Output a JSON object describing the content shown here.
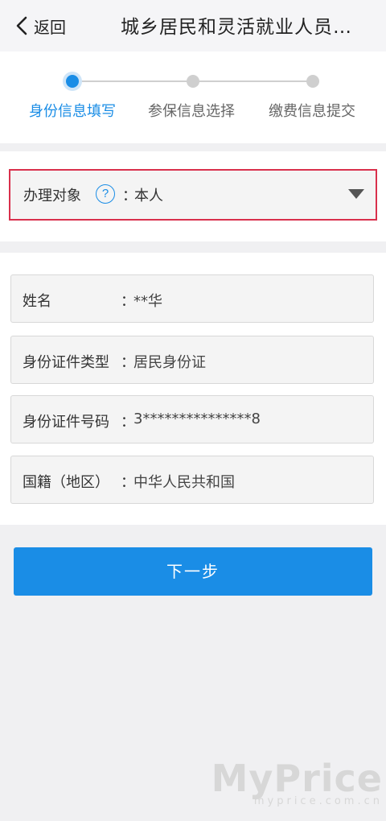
{
  "header": {
    "back_label": "返回",
    "title": "城乡居民和灵活就业人员…"
  },
  "stepper": {
    "steps": [
      {
        "label": "身份信息填写",
        "active": true
      },
      {
        "label": "参保信息选择",
        "active": false
      },
      {
        "label": "缴费信息提交",
        "active": false
      }
    ]
  },
  "applicant": {
    "label": "办理对象",
    "help_glyph": "?",
    "colon": "：",
    "value": "本人"
  },
  "identity": {
    "fields": [
      {
        "label": "姓名",
        "colon": "：",
        "value": "**华"
      },
      {
        "label": "身份证件类型",
        "colon": "：",
        "value": "居民身份证"
      },
      {
        "label": "身份证件号码",
        "colon": "：",
        "value": "3***************8"
      },
      {
        "label": "国籍（地区）",
        "colon": "：",
        "value": "中华人民共和国"
      }
    ]
  },
  "actions": {
    "next_label": "下一步"
  },
  "watermark": {
    "brand": "MyPrice",
    "domain": "myprice.com.cn"
  },
  "colors": {
    "accent": "#1a8de6",
    "highlight_border": "#d9304c",
    "inactive": "#cfcfcf"
  }
}
